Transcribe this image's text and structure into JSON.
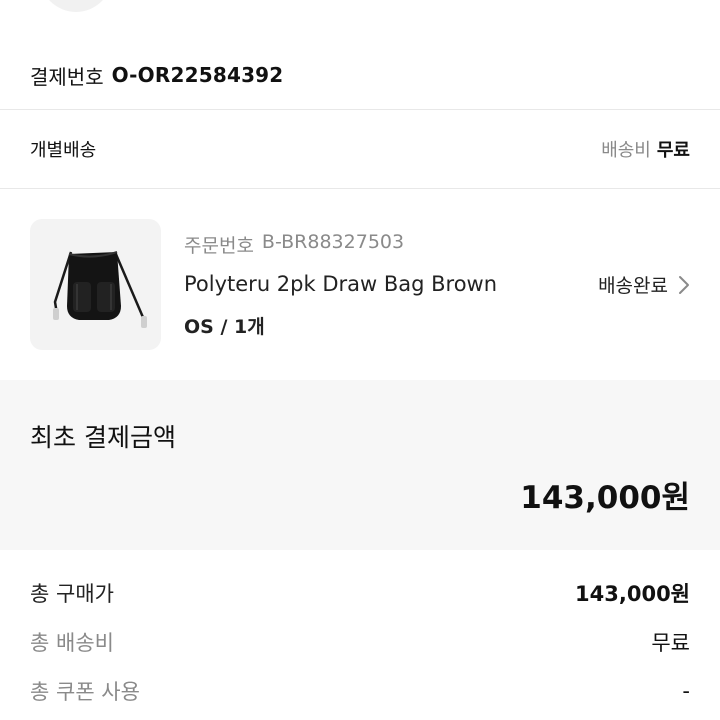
{
  "payment": {
    "label": "결제번호",
    "number": "O-OR22584392"
  },
  "shipping": {
    "title": "개별배송",
    "fee_label": "배송비",
    "fee_value": "무료"
  },
  "order": {
    "order_no_label": "주문번호",
    "order_no": "B-BR88327503",
    "product_name": "Polyteru 2pk Draw Bag Brown",
    "option": "OS / 1개",
    "status": "배송완료",
    "image_icon": "backpack-image"
  },
  "initial_payment": {
    "title": "최초 결제금액",
    "amount": "143,000원"
  },
  "summary": [
    {
      "label": "총 구매가",
      "value": "143,000원"
    },
    {
      "label": "총 배송비",
      "value": "무료"
    },
    {
      "label": "총 쿠폰 사용",
      "value": "-"
    }
  ]
}
